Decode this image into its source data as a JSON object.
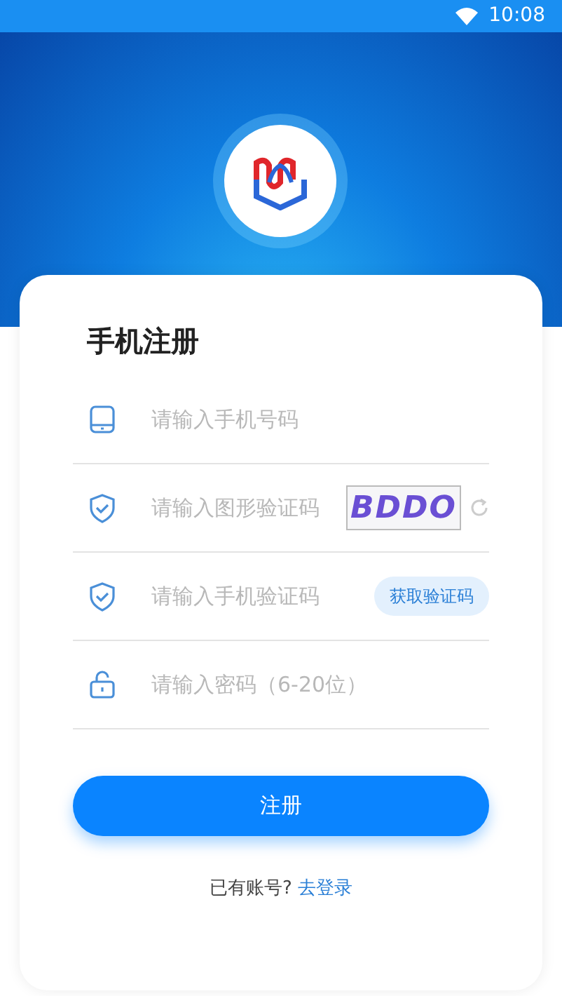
{
  "status_bar": {
    "time": "10:08"
  },
  "form": {
    "title": "手机注册",
    "fields": [
      {
        "kind": "phone",
        "placeholder": "请输入手机号码"
      },
      {
        "kind": "captcha",
        "placeholder": "请输入图形验证码",
        "captcha_text": "BDDO"
      },
      {
        "kind": "sms",
        "placeholder": "请输入手机验证码",
        "button": "获取验证码"
      },
      {
        "kind": "password",
        "placeholder": "请输入密码（6-20位）"
      }
    ],
    "submit": "注册",
    "footer": {
      "text": "已有账号?",
      "link": "去登录"
    }
  }
}
